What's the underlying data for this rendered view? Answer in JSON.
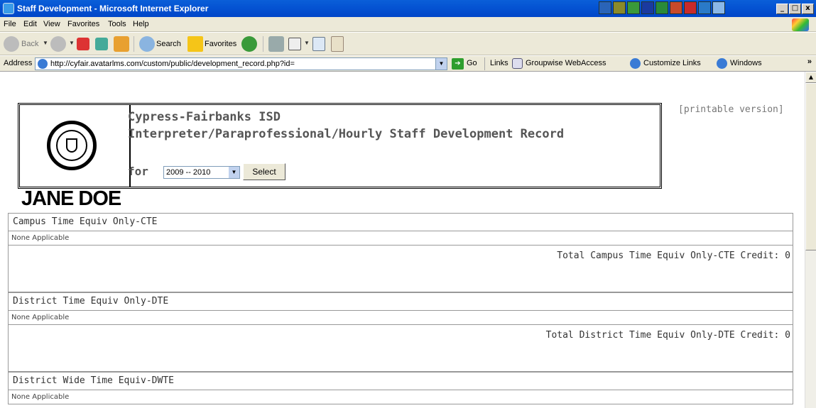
{
  "window": {
    "title": "Staff Development - Microsoft Internet Explorer",
    "minimize": "_",
    "maximize": "□",
    "close": "x"
  },
  "menu": [
    "File",
    "Edit",
    "View",
    "Favorites",
    "Tools",
    "Help"
  ],
  "toolbar": {
    "back": "Back",
    "search": "Search",
    "favorites": "Favorites"
  },
  "address": {
    "label": "Address",
    "url": "http://cyfair.avatarlms.com/custom/public/development_record.php?id=",
    "go": "Go",
    "links_label": "Links",
    "links": [
      "Groupwise WebAccess",
      "Customize Links",
      "Windows"
    ],
    "more": "»"
  },
  "page": {
    "printable": "[printable version]",
    "district": "Cypress-Fairbanks ISD",
    "record_title": "Interpreter/Paraprofessional/Hourly Staff Development Record",
    "for_label": "for",
    "year": "2009 -- 2010",
    "select_button": "Select",
    "name": "JANE DOE",
    "sections": [
      {
        "heading": "Campus Time Equiv Only-CTE",
        "status": "None Applicable",
        "total": "Total Campus Time Equiv Only-CTE Credit: 0"
      },
      {
        "heading": "District Time Equiv Only-DTE",
        "status": "None Applicable",
        "total": "Total District Time Equiv Only-DTE Credit: 0"
      },
      {
        "heading": "District Wide Time Equiv-DWTE",
        "status": "None Applicable"
      }
    ]
  },
  "colors": {
    "titlebar": "#0554d3",
    "chrome": "#ece9d8",
    "heading_text": "#555555"
  }
}
